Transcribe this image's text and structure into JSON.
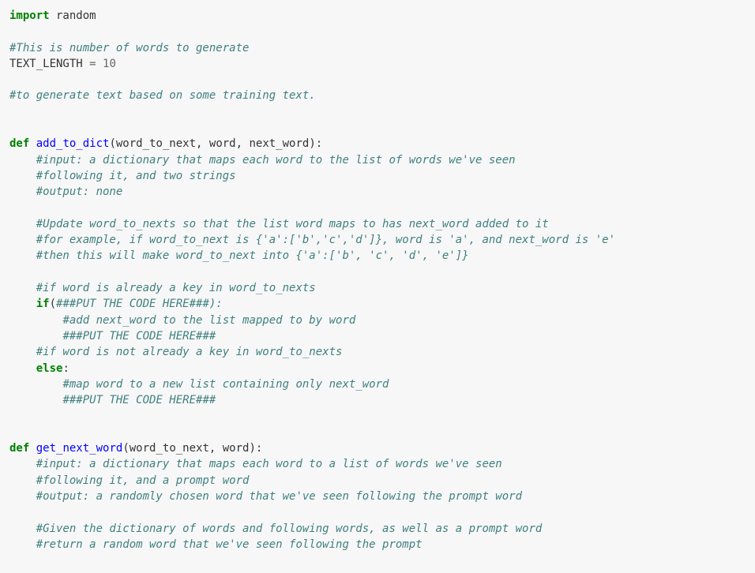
{
  "lines": [
    [
      {
        "cls": "tok-keyword",
        "t": "import"
      },
      {
        "cls": "tok-plain",
        "t": " random"
      }
    ],
    [],
    [
      {
        "cls": "tok-comment",
        "t": "#This is number of words to generate"
      }
    ],
    [
      {
        "cls": "tok-plain",
        "t": "TEXT_LENGTH "
      },
      {
        "cls": "tok-op",
        "t": "="
      },
      {
        "cls": "tok-plain",
        "t": " "
      },
      {
        "cls": "tok-number",
        "t": "10"
      }
    ],
    [],
    [
      {
        "cls": "tok-comment",
        "t": "#to generate text based on some training text."
      }
    ],
    [],
    [],
    [
      {
        "cls": "tok-keyword",
        "t": "def"
      },
      {
        "cls": "tok-plain",
        "t": " "
      },
      {
        "cls": "tok-defname",
        "t": "add_to_dict"
      },
      {
        "cls": "tok-plain",
        "t": "(word_to_next, word, next_word):"
      }
    ],
    [
      {
        "cls": "tok-plain",
        "t": "    "
      },
      {
        "cls": "tok-comment",
        "t": "#input: a dictionary that maps each word to the list of words we've seen"
      }
    ],
    [
      {
        "cls": "tok-plain",
        "t": "    "
      },
      {
        "cls": "tok-comment",
        "t": "#following it, and two strings"
      }
    ],
    [
      {
        "cls": "tok-plain",
        "t": "    "
      },
      {
        "cls": "tok-comment",
        "t": "#output: none"
      }
    ],
    [],
    [
      {
        "cls": "tok-plain",
        "t": "    "
      },
      {
        "cls": "tok-comment",
        "t": "#Update word_to_nexts so that the list word maps to has next_word added to it"
      }
    ],
    [
      {
        "cls": "tok-plain",
        "t": "    "
      },
      {
        "cls": "tok-comment",
        "t": "#for example, if word_to_next is {'a':['b','c','d']}, word is 'a', and next_word is 'e'"
      }
    ],
    [
      {
        "cls": "tok-plain",
        "t": "    "
      },
      {
        "cls": "tok-comment",
        "t": "#then this will make word_to_next into {'a':['b', 'c', 'd', 'e']}"
      }
    ],
    [],
    [
      {
        "cls": "tok-plain",
        "t": "    "
      },
      {
        "cls": "tok-comment",
        "t": "#if word is already a key in word_to_nexts"
      }
    ],
    [
      {
        "cls": "tok-plain",
        "t": "    "
      },
      {
        "cls": "tok-keyword",
        "t": "if"
      },
      {
        "cls": "tok-plain",
        "t": "("
      },
      {
        "cls": "tok-comment",
        "t": "###PUT THE CODE HERE###):"
      }
    ],
    [
      {
        "cls": "tok-plain",
        "t": "        "
      },
      {
        "cls": "tok-comment",
        "t": "#add next_word to the list mapped to by word"
      }
    ],
    [
      {
        "cls": "tok-plain",
        "t": "        "
      },
      {
        "cls": "tok-comment",
        "t": "###PUT THE CODE HERE###"
      }
    ],
    [
      {
        "cls": "tok-plain",
        "t": "    "
      },
      {
        "cls": "tok-comment",
        "t": "#if word is not already a key in word_to_nexts"
      }
    ],
    [
      {
        "cls": "tok-plain",
        "t": "    "
      },
      {
        "cls": "tok-keyword",
        "t": "else"
      },
      {
        "cls": "tok-plain",
        "t": ":"
      }
    ],
    [
      {
        "cls": "tok-plain",
        "t": "        "
      },
      {
        "cls": "tok-comment",
        "t": "#map word to a new list containing only next_word"
      }
    ],
    [
      {
        "cls": "tok-plain",
        "t": "        "
      },
      {
        "cls": "tok-comment",
        "t": "###PUT THE CODE HERE###"
      }
    ],
    [],
    [],
    [
      {
        "cls": "tok-keyword",
        "t": "def"
      },
      {
        "cls": "tok-plain",
        "t": " "
      },
      {
        "cls": "tok-defname",
        "t": "get_next_word"
      },
      {
        "cls": "tok-plain",
        "t": "(word_to_next, word):"
      }
    ],
    [
      {
        "cls": "tok-plain",
        "t": "    "
      },
      {
        "cls": "tok-comment",
        "t": "#input: a dictionary that maps each word to a list of words we've seen"
      }
    ],
    [
      {
        "cls": "tok-plain",
        "t": "    "
      },
      {
        "cls": "tok-comment",
        "t": "#following it, and a prompt word"
      }
    ],
    [
      {
        "cls": "tok-plain",
        "t": "    "
      },
      {
        "cls": "tok-comment",
        "t": "#output: a randomly chosen word that we've seen following the prompt word"
      }
    ],
    [],
    [
      {
        "cls": "tok-plain",
        "t": "    "
      },
      {
        "cls": "tok-comment",
        "t": "#Given the dictionary of words and following words, as well as a prompt word"
      }
    ],
    [
      {
        "cls": "tok-plain",
        "t": "    "
      },
      {
        "cls": "tok-comment",
        "t": "#return a random word that we've seen following the prompt"
      }
    ]
  ]
}
